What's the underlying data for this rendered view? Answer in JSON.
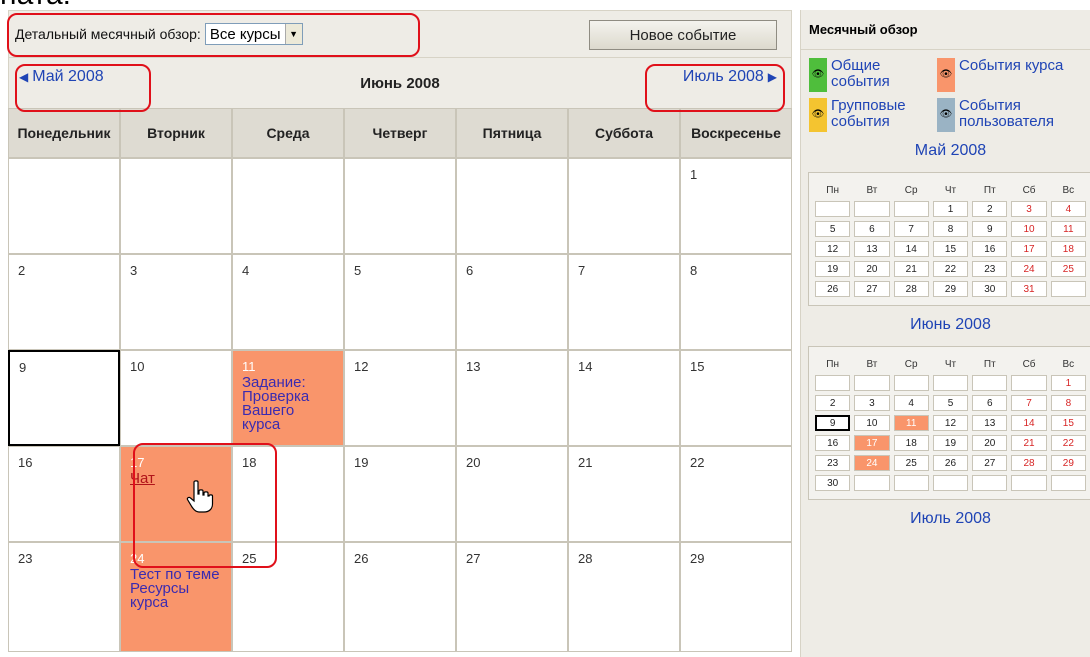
{
  "top_caption": "ната:",
  "toolbar": {
    "overview_label": "Детальный месячный обзор:",
    "course_select_value": "Все курсы",
    "new_event_label": "Новое событие"
  },
  "nav": {
    "prev_month": "Май 2008",
    "current_month": "Июнь 2008",
    "next_month": "Июль 2008"
  },
  "weekdays": [
    "Понедельник",
    "Вторник",
    "Среда",
    "Четверг",
    "Пятница",
    "Суббота",
    "Воскресенье"
  ],
  "weeks": [
    [
      {
        "d": ""
      },
      {
        "d": ""
      },
      {
        "d": ""
      },
      {
        "d": ""
      },
      {
        "d": ""
      },
      {
        "d": ""
      },
      {
        "d": "1"
      }
    ],
    [
      {
        "d": "2"
      },
      {
        "d": "3"
      },
      {
        "d": "4"
      },
      {
        "d": "5"
      },
      {
        "d": "6"
      },
      {
        "d": "7"
      },
      {
        "d": "8"
      }
    ],
    [
      {
        "d": "9",
        "today": true
      },
      {
        "d": "10"
      },
      {
        "d": "11",
        "event": "Задание: Проверка Вашего курса"
      },
      {
        "d": "12"
      },
      {
        "d": "13"
      },
      {
        "d": "14"
      },
      {
        "d": "15"
      }
    ],
    [
      {
        "d": "16"
      },
      {
        "d": "17",
        "event": "Чат"
      },
      {
        "d": "18"
      },
      {
        "d": "19"
      },
      {
        "d": "20"
      },
      {
        "d": "21"
      },
      {
        "d": "22"
      }
    ],
    [
      {
        "d": "23"
      },
      {
        "d": "24",
        "event": "Тест по теме Ресурсы курса"
      },
      {
        "d": "25"
      },
      {
        "d": "26"
      },
      {
        "d": "27"
      },
      {
        "d": "28"
      },
      {
        "d": "29"
      }
    ]
  ],
  "side": {
    "title": "Месячный обзор",
    "legend": [
      {
        "label": "Общие события",
        "color": "#4fbe3c"
      },
      {
        "label": "События курса",
        "color": "#f9956b"
      },
      {
        "label": "Групповые события",
        "color": "#f4c430"
      },
      {
        "label": "События пользователя",
        "color": "#9ab3c4"
      }
    ],
    "mini_weekdays": [
      "Пн",
      "Вт",
      "Ср",
      "Чт",
      "Пт",
      "Сб",
      "Вс"
    ],
    "may": {
      "title": "Май 2008",
      "weeks": [
        [
          "",
          "",
          "",
          "1",
          "2",
          "3",
          "4"
        ],
        [
          "5",
          "6",
          "7",
          "8",
          "9",
          "10",
          "11"
        ],
        [
          "12",
          "13",
          "14",
          "15",
          "16",
          "17",
          "18"
        ],
        [
          "19",
          "20",
          "21",
          "22",
          "23",
          "24",
          "25"
        ],
        [
          "26",
          "27",
          "28",
          "29",
          "30",
          "31",
          ""
        ]
      ]
    },
    "june": {
      "title": "Июнь 2008",
      "weeks": [
        [
          "",
          "",
          "",
          "",
          "",
          "",
          "1"
        ],
        [
          "2",
          "3",
          "4",
          "5",
          "6",
          "7",
          "8"
        ],
        [
          "9",
          "10",
          "11",
          "12",
          "13",
          "14",
          "15"
        ],
        [
          "16",
          "17",
          "18",
          "19",
          "20",
          "21",
          "22"
        ],
        [
          "23",
          "24",
          "25",
          "26",
          "27",
          "28",
          "29"
        ],
        [
          "30",
          "",
          "",
          "",
          "",
          "",
          ""
        ]
      ],
      "event_days": [
        "11",
        "17",
        "24"
      ],
      "today": "9"
    },
    "july": {
      "title": "Июль 2008"
    }
  },
  "colors": {
    "accent_link": "#1f44b5",
    "course_event": "#f9956b",
    "annotation": "#e0101a"
  }
}
